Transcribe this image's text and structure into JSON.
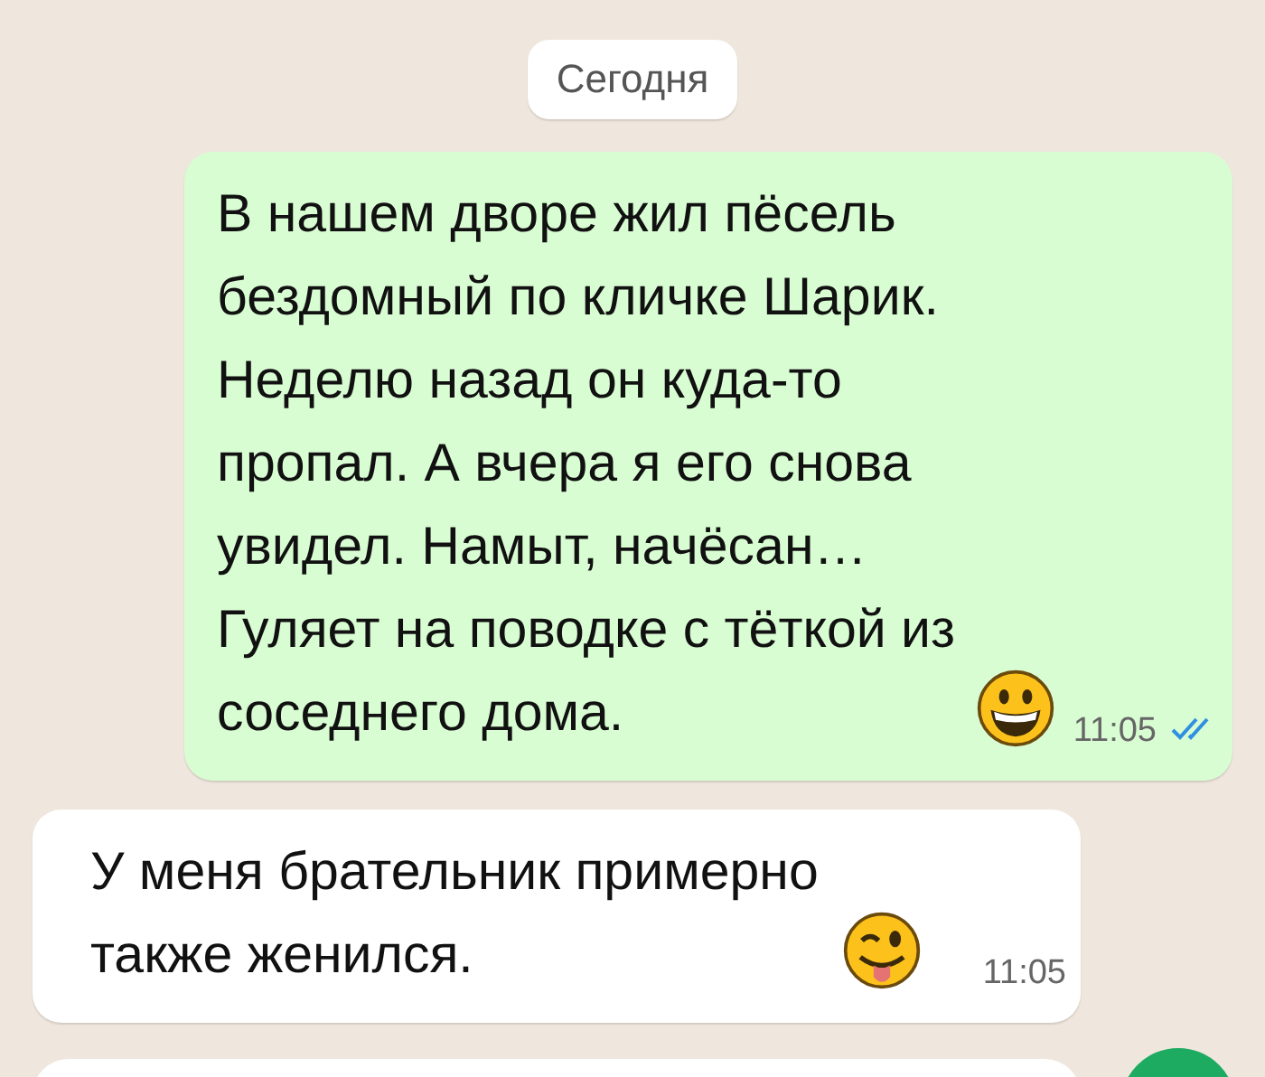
{
  "date_chip": "Сегодня",
  "messages": [
    {
      "kind": "outgoing",
      "text": "В нашем дворе жил пёсель бездомный по кличке Шарик. Неделю назад он куда-то пропал. А вчера я его снова увидел. Намыт, начёсан… Гуляет на поводке с тёткой из соседнего дома.",
      "emoji": {
        "kind": "grinning"
      },
      "time": "11:05",
      "read": true
    },
    {
      "kind": "incoming",
      "text": "У меня брательник примерно также женился.",
      "emoji": {
        "kind": "winking"
      },
      "time": "11:05"
    }
  ]
}
